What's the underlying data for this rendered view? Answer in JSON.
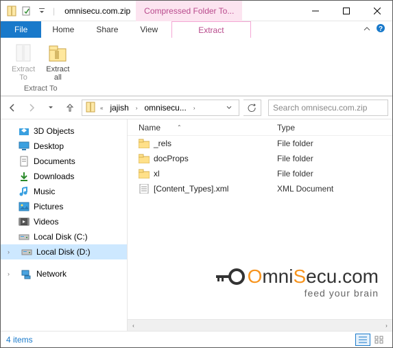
{
  "title": "omnisecu.com.zip",
  "context_tab": "Compressed Folder To...",
  "tabs": {
    "file": "File",
    "home": "Home",
    "share": "Share",
    "view": "View",
    "extract": "Extract"
  },
  "ribbon": {
    "extract_to": "Extract\nTo",
    "extract_all": "Extract\nall",
    "group_label": "Extract To"
  },
  "breadcrumb": {
    "parts": [
      "jajish",
      "omnisecu..."
    ]
  },
  "search_placeholder": "Search omnisecu.com.zip",
  "columns": {
    "name": "Name",
    "type": "Type"
  },
  "tree": [
    {
      "icon": "3d",
      "label": "3D Objects"
    },
    {
      "icon": "desktop",
      "label": "Desktop"
    },
    {
      "icon": "documents",
      "label": "Documents"
    },
    {
      "icon": "downloads",
      "label": "Downloads"
    },
    {
      "icon": "music",
      "label": "Music"
    },
    {
      "icon": "pictures",
      "label": "Pictures"
    },
    {
      "icon": "videos",
      "label": "Videos"
    },
    {
      "icon": "disk",
      "label": "Local Disk (C:)"
    },
    {
      "icon": "disk",
      "label": "Local Disk (D:)",
      "selected": true,
      "expandable": true
    }
  ],
  "tree_network": "Network",
  "files": [
    {
      "name": "_rels",
      "type": "File folder",
      "icon": "folder"
    },
    {
      "name": "docProps",
      "type": "File folder",
      "icon": "folder"
    },
    {
      "name": "xl",
      "type": "File folder",
      "icon": "folder"
    },
    {
      "name": "[Content_Types].xml",
      "type": "XML Document",
      "icon": "xml"
    }
  ],
  "status": "4 items",
  "watermark": {
    "pre": "mni",
    "mid": "S",
    "post": "ecu.com",
    "tagline": "feed your brain"
  }
}
